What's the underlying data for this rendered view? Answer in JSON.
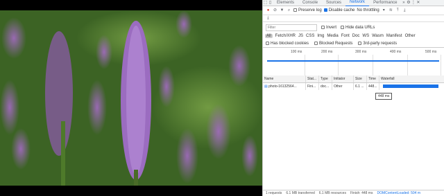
{
  "devtools": {
    "tabs": [
      {
        "label": "Elements"
      },
      {
        "label": "Console"
      },
      {
        "label": "Sources"
      },
      {
        "label": "Network"
      },
      {
        "label": "Performance"
      }
    ],
    "more_tabs": "»",
    "toolbar": {
      "preserve_log": "Preserve log",
      "disable_cache": "Disable cache",
      "throttling": "No throttling"
    },
    "filter": {
      "placeholder": "Filter",
      "invert": "Invert",
      "hide_data_urls": "Hide data URLs"
    },
    "types": [
      "All",
      "Fetch/XHR",
      "JS",
      "CSS",
      "Img",
      "Media",
      "Font",
      "Doc",
      "WS",
      "Wasm",
      "Manifest",
      "Other"
    ],
    "blocked": {
      "has_blocked_cookies": "Has blocked cookies",
      "blocked_requests": "Blocked Requests",
      "third_party": "3rd-party requests"
    },
    "timeline_ticks": [
      "100 ms",
      "200 ms",
      "300 ms",
      "400 ms",
      "500 ms"
    ],
    "table": {
      "headers": [
        "Name",
        "Stat...",
        "Type",
        "Initiator",
        "Size",
        "Time",
        "Waterfall"
      ],
      "rows": [
        [
          "photo-16132564...",
          "Fini...",
          "doc...",
          "Other",
          "6.1 ...",
          "448..."
        ]
      ]
    },
    "tooltip": "448 ms",
    "status": {
      "requests": "1 requests",
      "transferred": "6.1 MB transferred",
      "resources": "6.1 MB resources",
      "finish": "Finish: 448 ms",
      "dom_content_loaded": "DOMContentLoaded: 504 m"
    }
  },
  "colors": {
    "accent": "#1a73e8",
    "record": "#d93025"
  }
}
